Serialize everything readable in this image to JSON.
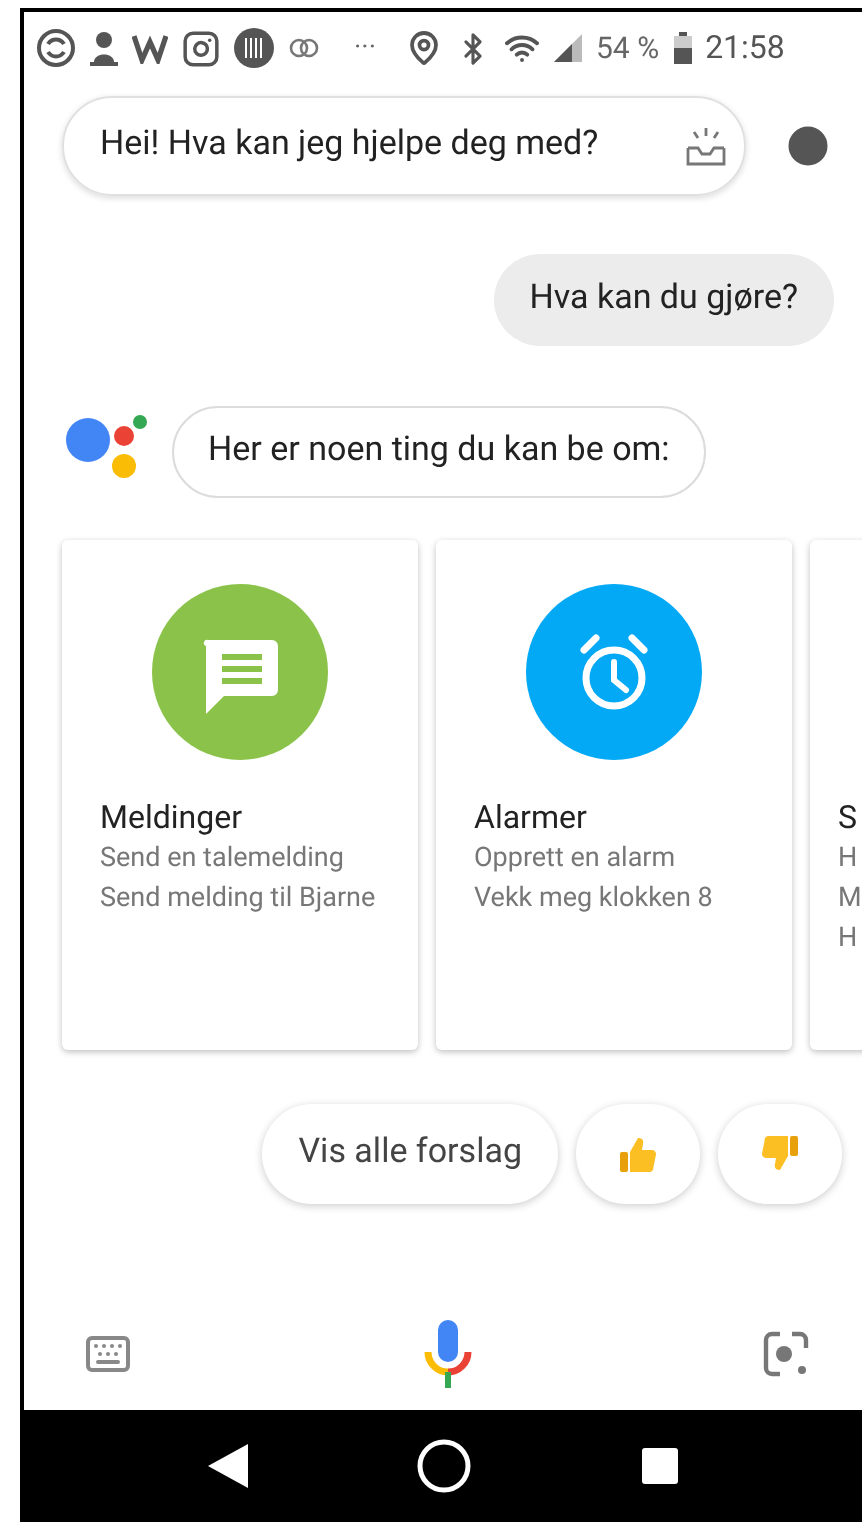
{
  "status_bar": {
    "battery": "54 %",
    "time": "21:58",
    "more": "···"
  },
  "greeting": {
    "text": "Hei! Hva kan jeg hjelpe deg med?"
  },
  "user_message": {
    "text": "Hva kan du gjøre?"
  },
  "assistant_message": {
    "text": "Her er noen ting du kan be om:"
  },
  "cards": [
    {
      "kind": "messages",
      "title": "Meldinger",
      "lines": [
        "Send en talemelding",
        "Send melding til Bjarne"
      ],
      "color": "#8bc34a"
    },
    {
      "kind": "alarm",
      "title": "Alarmer",
      "lines": [
        "Opprett en alarm",
        "Vekk meg klokken 8"
      ],
      "color": "#03a9f4"
    },
    {
      "kind": "partial",
      "title": "S",
      "lines": [
        "H",
        "M",
        "H"
      ]
    }
  ],
  "suggestions": {
    "label": "Vis alle forslag"
  }
}
